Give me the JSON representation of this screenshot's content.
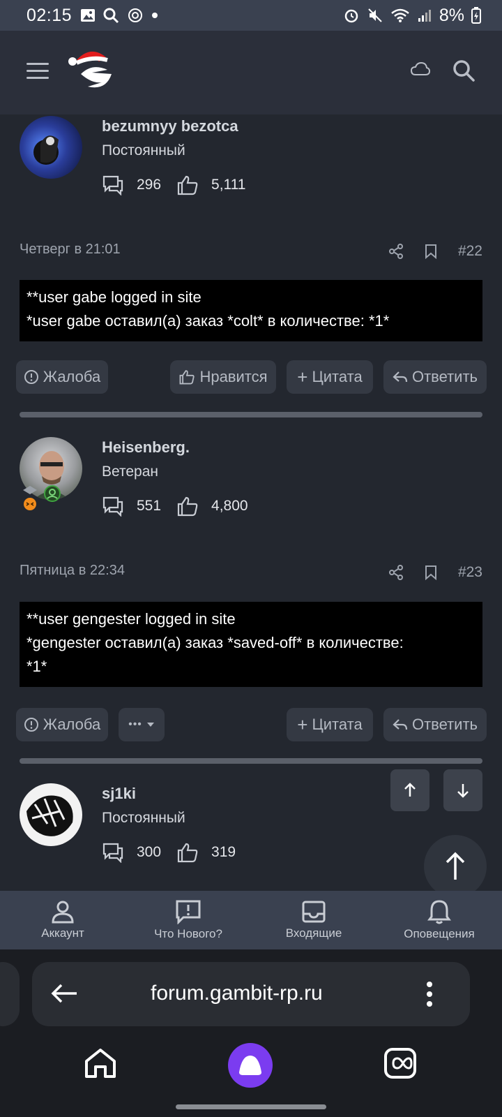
{
  "status_bar": {
    "time": "02:15",
    "battery": "8%"
  },
  "posts": [
    {
      "username": "bezumnyy bezotca",
      "role": "Постоянный",
      "messages": "296",
      "likes": "5,111",
      "date": "Четверг в 21:01",
      "number": "#22",
      "lines": [
        "**user gabe logged in site",
        "*user gabe оставил(а) заказ *colt* в количестве: *1*"
      ],
      "actions": {
        "report": "Жалоба",
        "like": "Нравится",
        "quote": "Цитата",
        "reply": "Ответить"
      }
    },
    {
      "username": "Heisenberg.",
      "role": "Ветеран",
      "messages": "551",
      "likes": "4,800",
      "date": "Пятница в 22:34",
      "number": "#23",
      "lines": [
        "**user gengester logged in site",
        "*gengester оставил(а) заказ *saved-off* в количестве:",
        "*1*"
      ],
      "actions": {
        "report": "Жалоба",
        "more": "•••",
        "quote": "Цитата",
        "reply": "Ответить"
      }
    },
    {
      "username": "sj1ki",
      "role": "Постоянный",
      "messages": "300",
      "likes": "319"
    }
  ],
  "bottom_nav": [
    {
      "label": "Аккаунт",
      "icon": "account-icon"
    },
    {
      "label": "Что Нового?",
      "icon": "whats-new-icon"
    },
    {
      "label": "Входящие",
      "icon": "inbox-icon"
    },
    {
      "label": "Оповещения",
      "icon": "bell-icon"
    }
  ],
  "browser": {
    "url": "forum.gambit-rp.ru"
  },
  "colors": {
    "accent_purple": "#7b3cf0",
    "background": "#23272f"
  }
}
